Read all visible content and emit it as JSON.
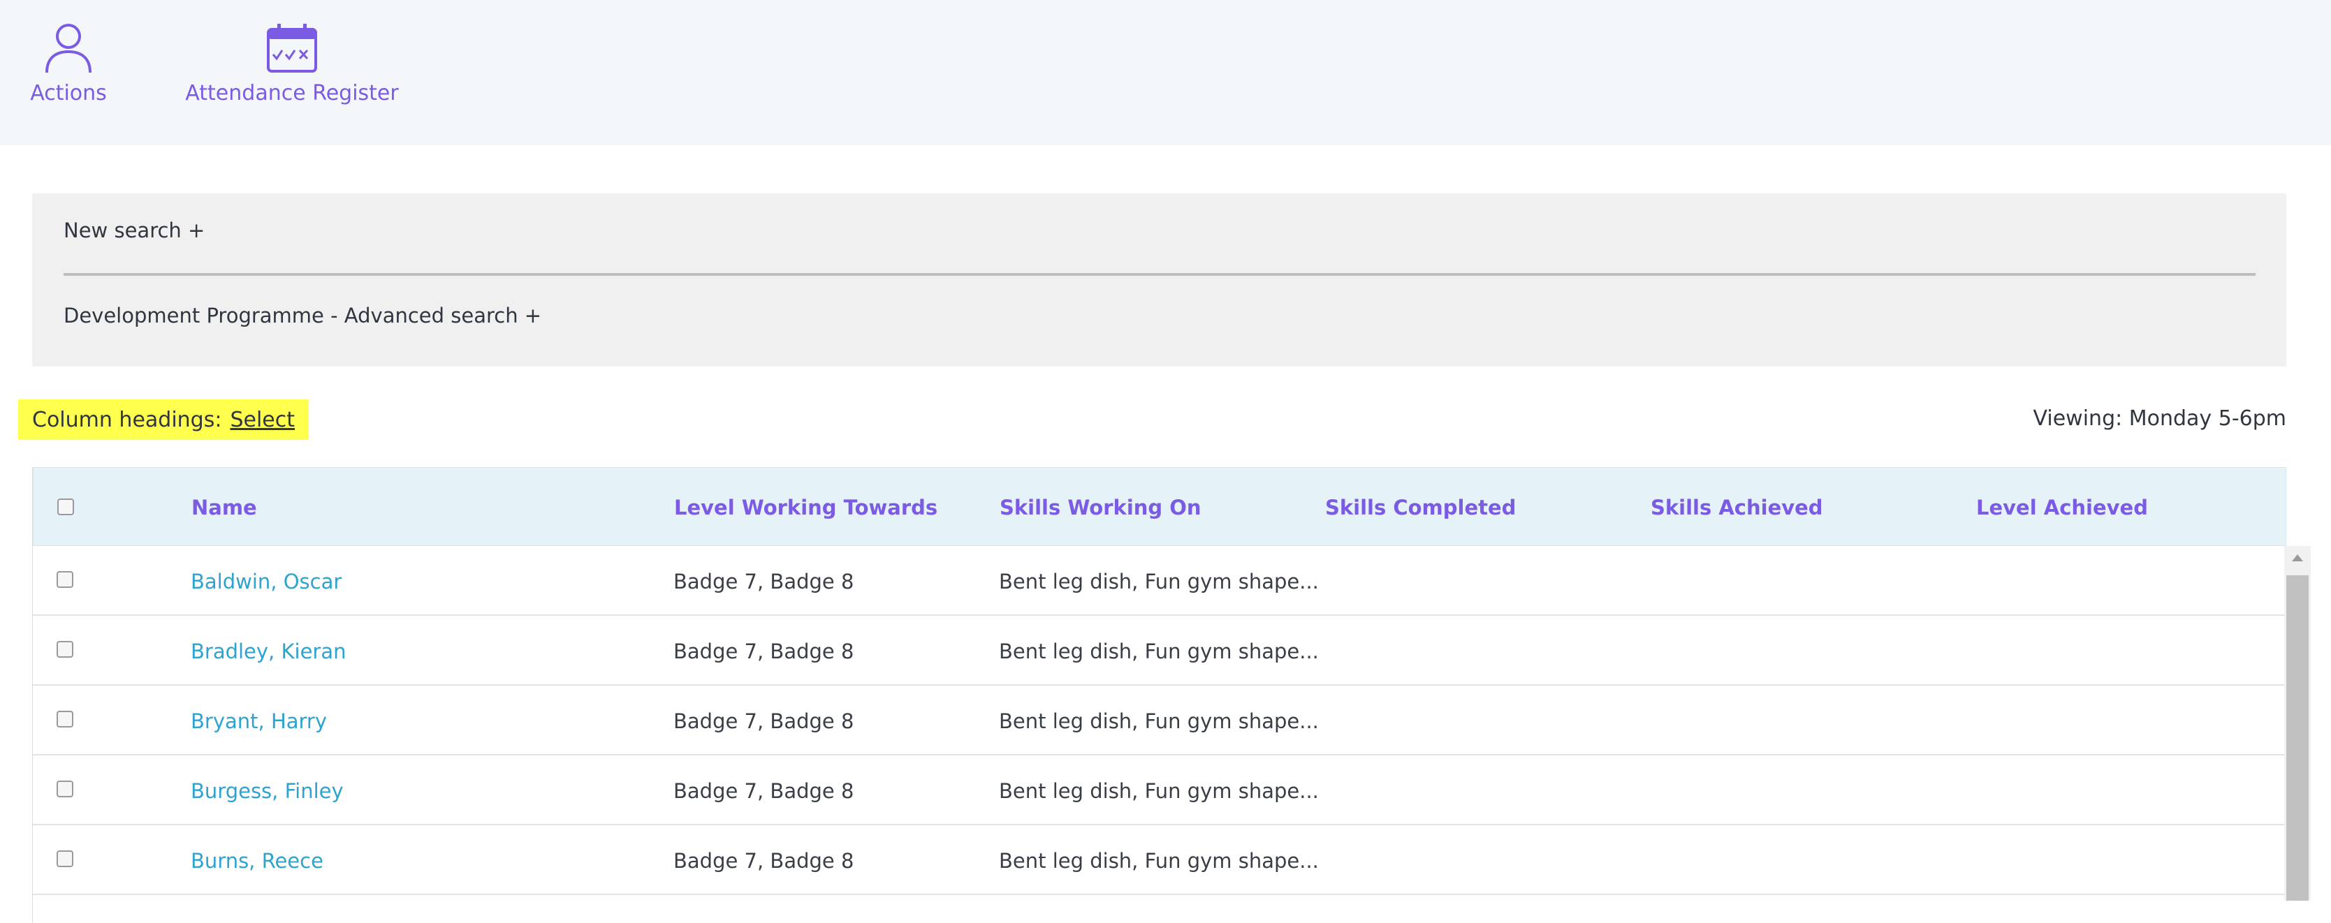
{
  "toolbar": {
    "actions_label": "Actions",
    "attendance_label": "Attendance Register",
    "actions_icon": "user-icon",
    "attendance_icon": "calendar-check-icon"
  },
  "search": {
    "new_search": "New search +",
    "advanced_search": "Development Programme - Advanced search +"
  },
  "column_headings": {
    "label": "Column headings:",
    "select_link": "Select",
    "highlight_color": "#ffff4d"
  },
  "viewing": "Viewing: Monday 5-6pm",
  "table": {
    "columns": [
      "Name",
      "Level Working Towards",
      "Skills Working On",
      "Skills Completed",
      "Skills Achieved",
      "Level Achieved"
    ],
    "rows": [
      {
        "name": "Baldwin, Oscar",
        "level": "Badge 7, Badge 8",
        "skills": "Bent leg dish, Fun gym shape...",
        "completed": "",
        "achieved": "",
        "level_achieved": ""
      },
      {
        "name": "Bradley, Kieran",
        "level": "Badge 7, Badge 8",
        "skills": "Bent leg dish, Fun gym shape...",
        "completed": "",
        "achieved": "",
        "level_achieved": ""
      },
      {
        "name": "Bryant, Harry",
        "level": "Badge 7, Badge 8",
        "skills": "Bent leg dish, Fun gym shape...",
        "completed": "",
        "achieved": "",
        "level_achieved": ""
      },
      {
        "name": "Burgess, Finley",
        "level": "Badge 7, Badge 8",
        "skills": "Bent leg dish, Fun gym shape...",
        "completed": "",
        "achieved": "",
        "level_achieved": ""
      },
      {
        "name": "Burns, Reece",
        "level": "Badge 7, Badge 8",
        "skills": "Bent leg dish, Fun gym shape...",
        "completed": "",
        "achieved": "",
        "level_achieved": ""
      }
    ]
  },
  "colors": {
    "accent": "#7b5be3",
    "link": "#2ea3cf",
    "header_bg": "#e5f2f8",
    "toolbar_bg": "#f4f7fa"
  }
}
